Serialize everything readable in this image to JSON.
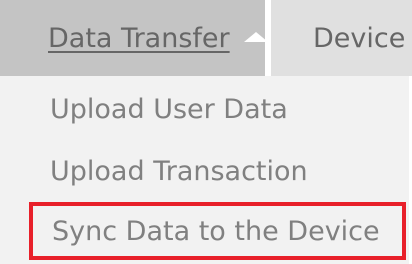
{
  "menubar": {
    "tabs": [
      {
        "label": "Data Transfer",
        "active": true
      },
      {
        "label": "Device",
        "active": false
      }
    ]
  },
  "dropdown": {
    "items": [
      {
        "label": "Upload User Data"
      },
      {
        "label": "Upload Transaction"
      },
      {
        "label": "Sync Data to the Device",
        "highlighted": true
      }
    ]
  },
  "colors": {
    "active_tab_bg": "#c4c4c4",
    "inactive_tab_bg": "#e0e0e0",
    "dropdown_bg": "#f2f2f2",
    "text": "#808080",
    "highlight_border": "#e8202a"
  },
  "icons": {
    "dropdown_indicator": "caret-up-icon"
  }
}
